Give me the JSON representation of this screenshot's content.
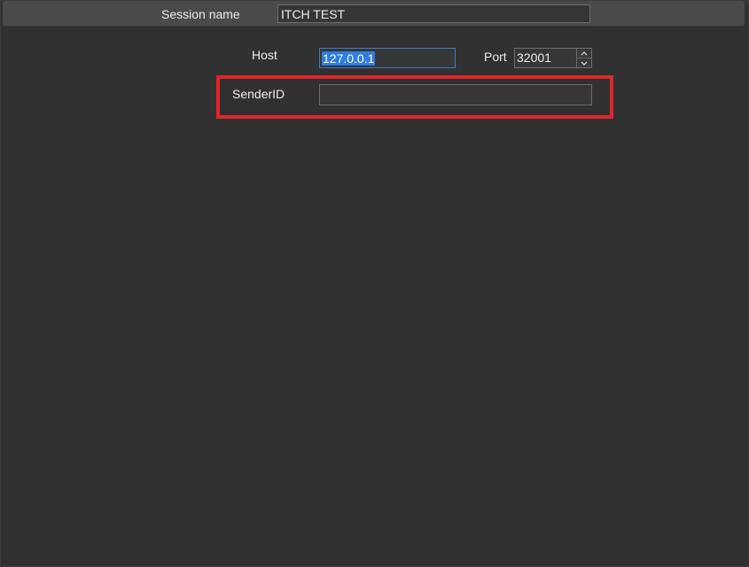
{
  "session": {
    "label": "Session name",
    "value": "ITCH TEST"
  },
  "host": {
    "label": "Host",
    "value": "127.0.0.1"
  },
  "port": {
    "label": "Port",
    "value": "32001"
  },
  "sender": {
    "label": "SenderID",
    "value": ""
  },
  "colors": {
    "background": "#313131",
    "header": "#4a4a4a",
    "selection": "#2f7ddf",
    "focus_border": "#3e7ac8",
    "highlight": "#e0262b"
  },
  "icons": {
    "spin_up": "chevron-up-icon",
    "spin_down": "chevron-down-icon"
  }
}
